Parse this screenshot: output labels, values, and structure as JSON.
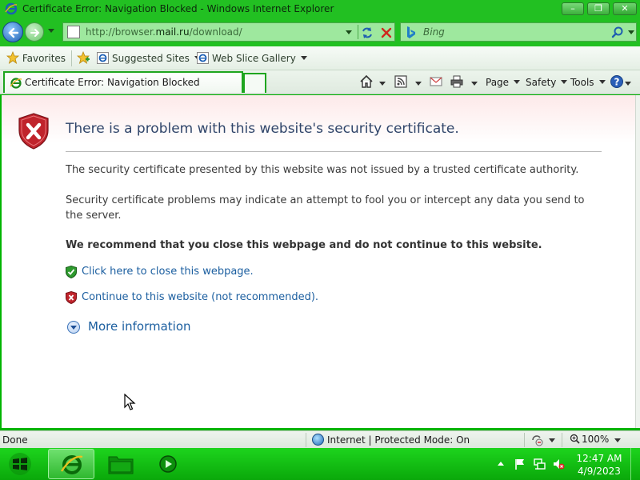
{
  "window": {
    "title": "Certificate Error: Navigation Blocked - Windows Internet Explorer",
    "minimize_label": "–",
    "maximize_label": "❐",
    "close_label": "✕"
  },
  "address_bar": {
    "url_prefix": "http://browser.",
    "url_domain": "mail.ru",
    "url_suffix": "/download/"
  },
  "search": {
    "placeholder": "Bing"
  },
  "favorites_bar": {
    "favorites_label": "Favorites",
    "items": [
      {
        "label": "Suggested Sites"
      },
      {
        "label": "Web Slice Gallery"
      }
    ]
  },
  "tabs": [
    {
      "label": "Certificate Error: Navigation Blocked",
      "active": true
    }
  ],
  "command_bar": {
    "page_label": "Page",
    "safety_label": "Safety",
    "tools_label": "Tools"
  },
  "page": {
    "heading": "There is a problem with this website's security certificate.",
    "paragraph1": "The security certificate presented by this website was not issued by a trusted certificate authority.",
    "paragraph2": "Security certificate problems may indicate an attempt to fool you or intercept any data you send to the server.",
    "recommendation": "We recommend that you close this webpage and do not continue to this website.",
    "close_link": "Click here to close this webpage.",
    "continue_link": "Continue to this website (not recommended).",
    "more_info": "More information"
  },
  "status_bar": {
    "status": "Done",
    "zone": "Internet | Protected Mode: On",
    "zoom": "100%"
  },
  "taskbar": {
    "time": "12:47 AM",
    "date": "4/9/2023"
  },
  "colors": {
    "chrome_green": "#22c022",
    "taskbar_green": "#0aa80a",
    "link_blue": "#1c5fa0",
    "heading_blue": "#30456a",
    "shield_red": "#c0242c",
    "shield_green": "#2e9a2e"
  }
}
